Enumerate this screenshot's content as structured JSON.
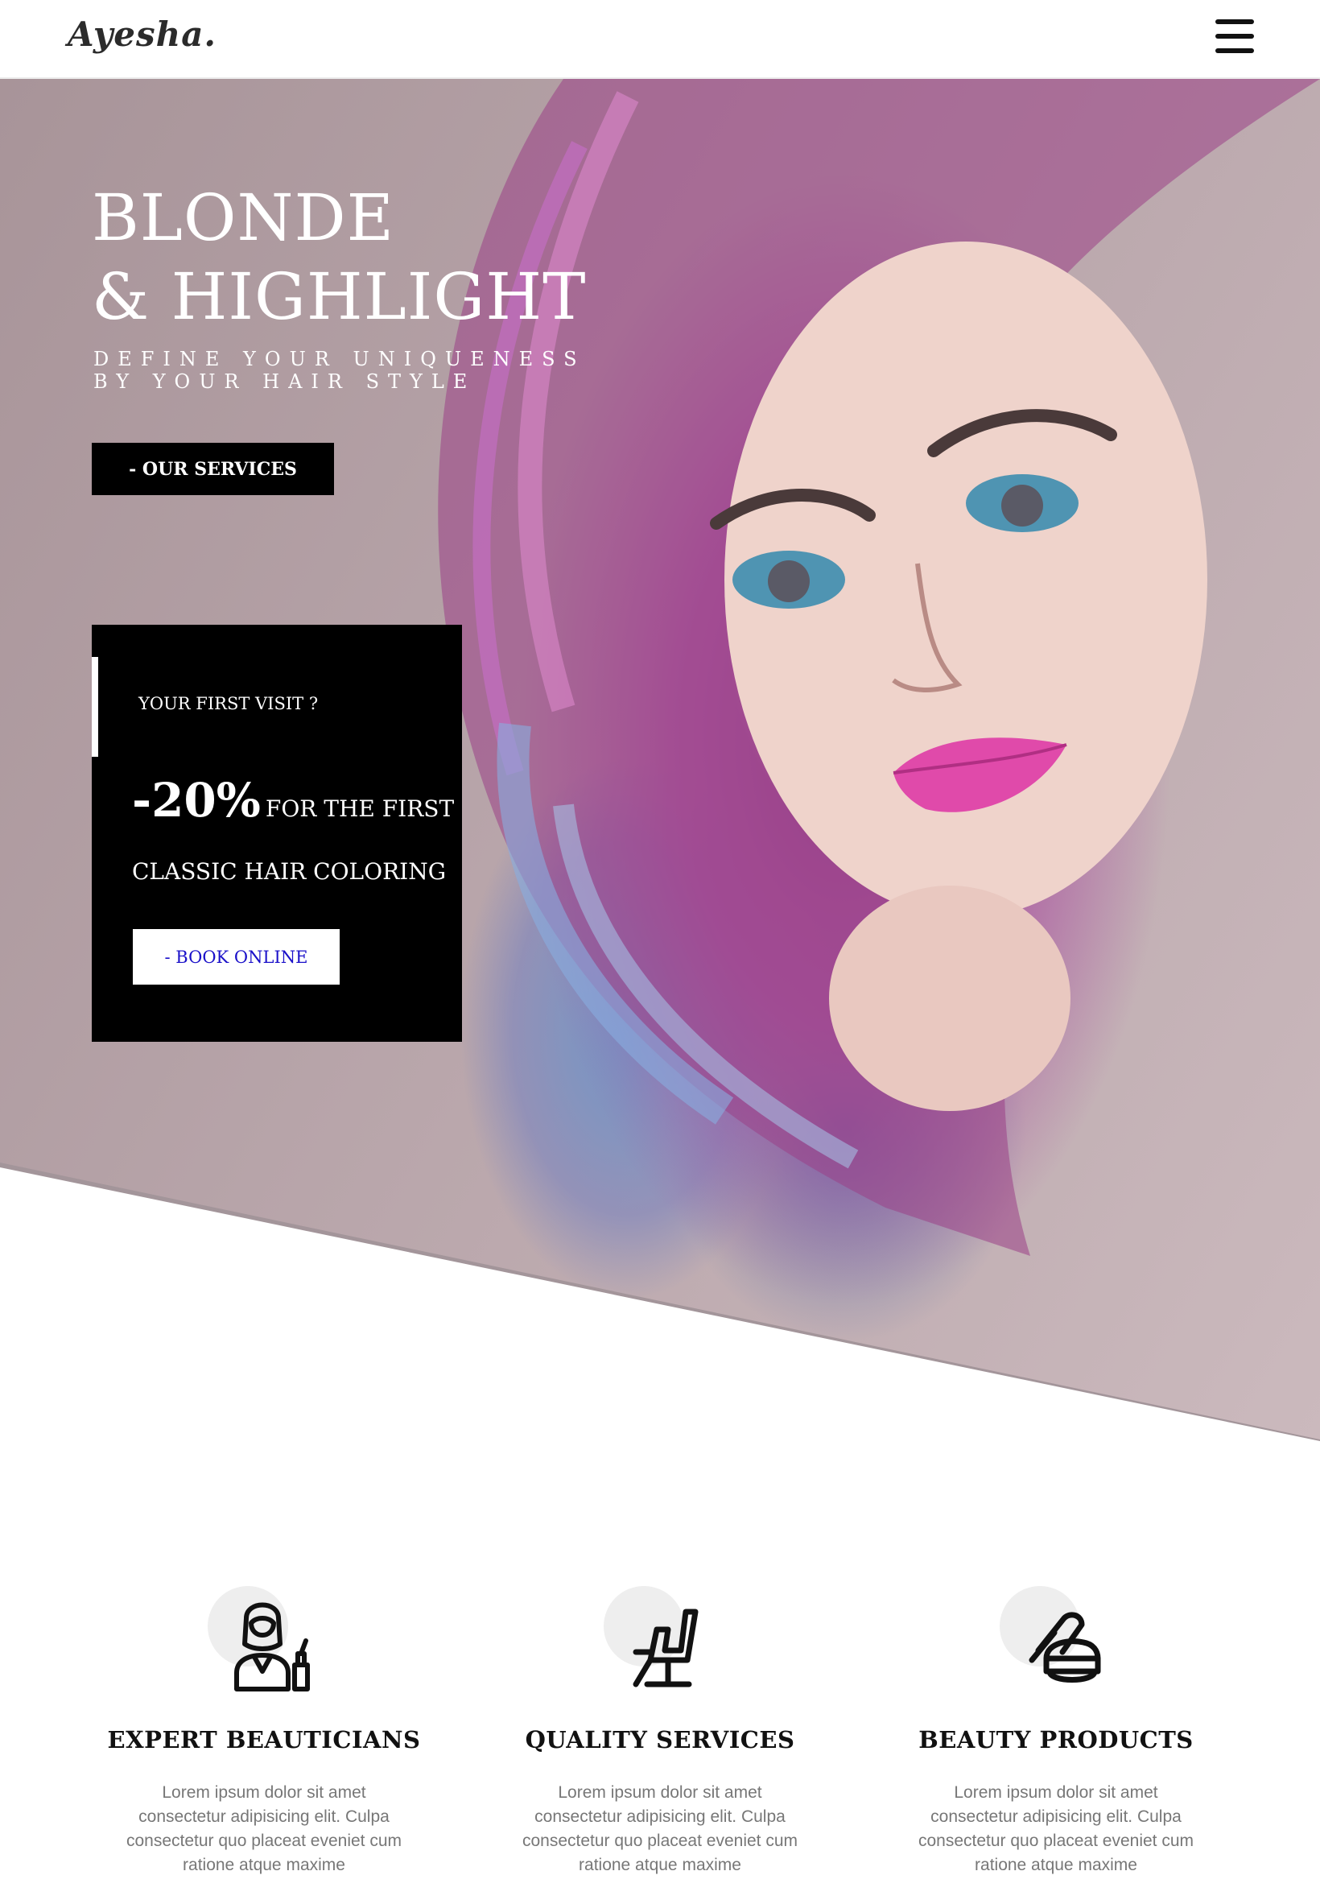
{
  "header": {
    "logo": "Ayesha.",
    "menu_icon": "hamburger-menu-icon"
  },
  "hero": {
    "title_line1": "BLONDE",
    "title_line2": "& HIGHLIGHT",
    "subtitle_line1": "DEFINE YOUR UNIQUENESS",
    "subtitle_line2": "BY YOUR HAIR STYLE",
    "services_button": "- OUR SERVICES"
  },
  "promo": {
    "visit_label": "YOUR FIRST VISIT ?",
    "discount": "-20%",
    "discount_suffix": "FOR THE FIRST",
    "offer_line": "CLASSIC HAIR COLORING",
    "book_button": "- BOOK ONLINE"
  },
  "features": [
    {
      "icon": "beautician-icon",
      "title": "EXPERT BEAUTICIANS",
      "text": "Lorem ipsum dolor sit amet consectetur adipisicing elit. Culpa consectetur quo placeat eveniet cum ratione atque maxime"
    },
    {
      "icon": "salon-chair-icon",
      "title": "QUALITY SERVICES",
      "text": "Lorem ipsum dolor sit amet consectetur adipisicing elit. Culpa consectetur quo placeat eveniet cum ratione atque maxime"
    },
    {
      "icon": "cosmetics-jar-icon",
      "title": "BEAUTY PRODUCTS",
      "text": "Lorem ipsum dolor sit amet consectetur adipisicing elit. Culpa consectetur quo placeat eveniet cum ratione atque maxime"
    }
  ],
  "colors": {
    "accent": "#000000",
    "book_text": "#1a10c9",
    "body_text": "#777777"
  }
}
